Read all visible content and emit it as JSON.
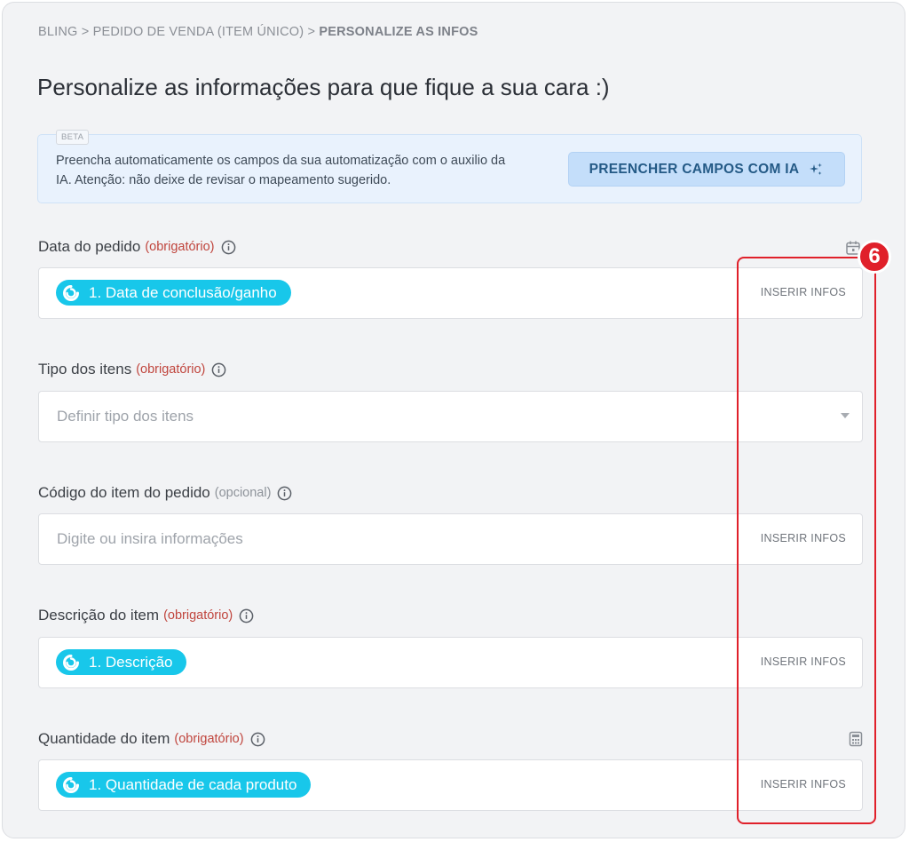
{
  "breadcrumb": {
    "part1": "BLING > PEDIDO DE VENDA (ITEM ÚNICO) > ",
    "current": "PERSONALIZE AS INFOS"
  },
  "page_title": "Personalize as informações para que fique a sua cara :)",
  "ai_box": {
    "badge": "BETA",
    "text": "Preencha automaticamente os campos da sua automatização com o auxilio da IA. Atenção: não deixe de revisar o mapeamento sugerido.",
    "button_label": "PREENCHER CAMPOS COM IA"
  },
  "fields": [
    {
      "label": "Data do pedido",
      "tag": "(obrigatório)",
      "pill": "1. Data de conclusão/ganho",
      "action": "INSERIR INFOS",
      "side_icon": "calendar-icon"
    },
    {
      "label": "Tipo dos itens",
      "tag": "(obrigatório)",
      "placeholder": "Definir tipo dos itens"
    },
    {
      "label": "Código do item do pedido",
      "tag": "(opcional)",
      "placeholder": "Digite ou insira informações",
      "action": "INSERIR INFOS"
    },
    {
      "label": "Descrição do item",
      "tag": "(obrigatório)",
      "pill": "1. Descrição",
      "action": "INSERIR INFOS"
    },
    {
      "label": "Quantidade do item",
      "tag": "(obrigatório)",
      "pill": "1. Quantidade de cada produto",
      "action": "INSERIR INFOS",
      "side_icon": "calculator-icon"
    }
  ],
  "annotation": {
    "step_number": "6",
    "color": "#e0202a"
  },
  "colors": {
    "pill": "#18c7ea",
    "required": "#c0453d",
    "ai_button": "#c4defa"
  }
}
